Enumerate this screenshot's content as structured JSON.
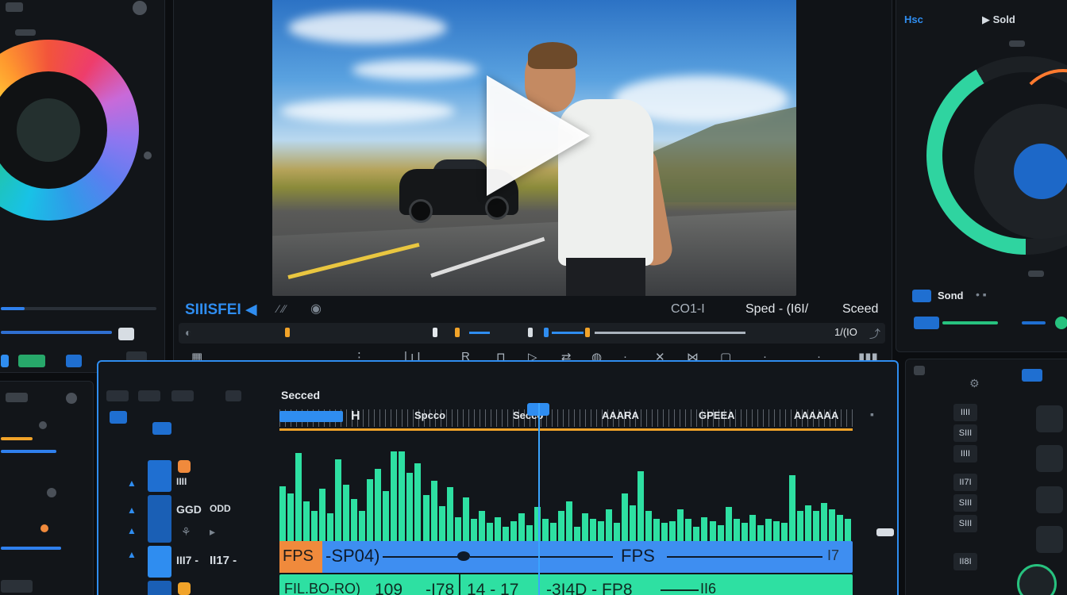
{
  "viewer": {
    "labels": {
      "clip_name": "SIIISFEI ◀",
      "timecode": "CO1-I",
      "speed_label": "Sped - (I6I/",
      "speed_right": "Sceed",
      "scrub_time": "1/(IO"
    }
  },
  "scopes": {
    "tab_1": "Hsc",
    "tab_2": "▶ Sold",
    "lower_label": "Sond"
  },
  "timeline": {
    "title": "Secced",
    "ruler_labels": [
      "H",
      "Spcco",
      "Secco",
      "AAARA",
      "GPEEA",
      "AAAAAA"
    ],
    "track_labels": [
      "IIII",
      "GGD",
      "ODD",
      "III7 -",
      "II17 -"
    ],
    "clip_blue": {
      "tag": "FPS",
      "left_text": "-SP04)",
      "mid_text": "FPS",
      "end_text": "I7"
    },
    "clip_green": [
      "FIL.BO-RO)",
      "109",
      "-I78",
      "14 - 17",
      "-3I4D - FP8",
      "II6"
    ],
    "waveform_levels": [
      0.55,
      0.48,
      0.88,
      0.4,
      0.3,
      0.52,
      0.28,
      0.82,
      0.56,
      0.42,
      0.3,
      0.62,
      0.72,
      0.5,
      0.9,
      0.9,
      0.68,
      0.78,
      0.46,
      0.6,
      0.35,
      0.54,
      0.24,
      0.44,
      0.22,
      0.3,
      0.18,
      0.24,
      0.14,
      0.2,
      0.28,
      0.16,
      0.34,
      0.22,
      0.18,
      0.3,
      0.4,
      0.14,
      0.28,
      0.22,
      0.2,
      0.32,
      0.18,
      0.48,
      0.36,
      0.7,
      0.3,
      0.22,
      0.18,
      0.2,
      0.32,
      0.22,
      0.14,
      0.24,
      0.2,
      0.16,
      0.34,
      0.22,
      0.18,
      0.26,
      0.16,
      0.22,
      0.2,
      0.18,
      0.66,
      0.3,
      0.36,
      0.3,
      0.38,
      0.32,
      0.26,
      0.22
    ]
  },
  "bottom_right": {
    "cells": [
      "IIII",
      "SIII",
      "IIII",
      "II7I",
      "SIII",
      "SIII",
      "II8I"
    ]
  },
  "colors": {
    "accent": "#2f8df0",
    "waveform": "#2ee0a2",
    "clip_orange": "#f08a3c",
    "ruler_orange": "#f1a329"
  }
}
